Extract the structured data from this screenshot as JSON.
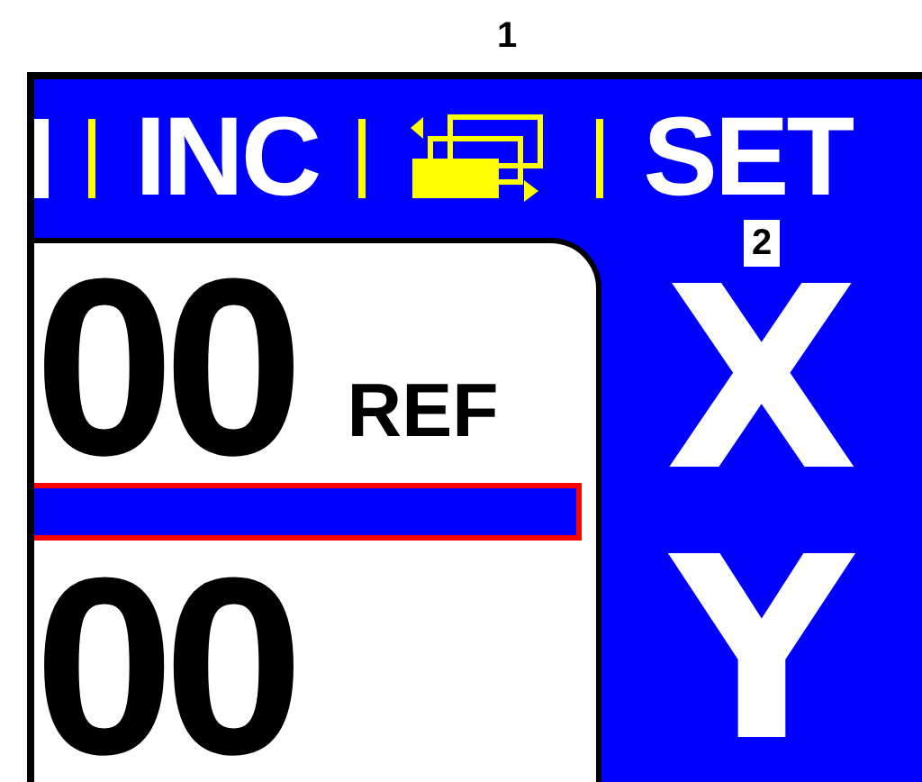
{
  "callouts": [
    {
      "label": "1"
    },
    {
      "label": "2"
    }
  ],
  "status_bar": {
    "items": [
      {
        "kind": "separator"
      },
      {
        "kind": "text",
        "label": "INC"
      },
      {
        "kind": "separator"
      },
      {
        "kind": "icon"
      },
      {
        "kind": "separator"
      },
      {
        "kind": "text",
        "label": "SET"
      }
    ]
  },
  "axes": [
    {
      "value": "00",
      "status": "REF",
      "label": "X"
    },
    {
      "value": "00",
      "label": "Y"
    }
  ]
}
